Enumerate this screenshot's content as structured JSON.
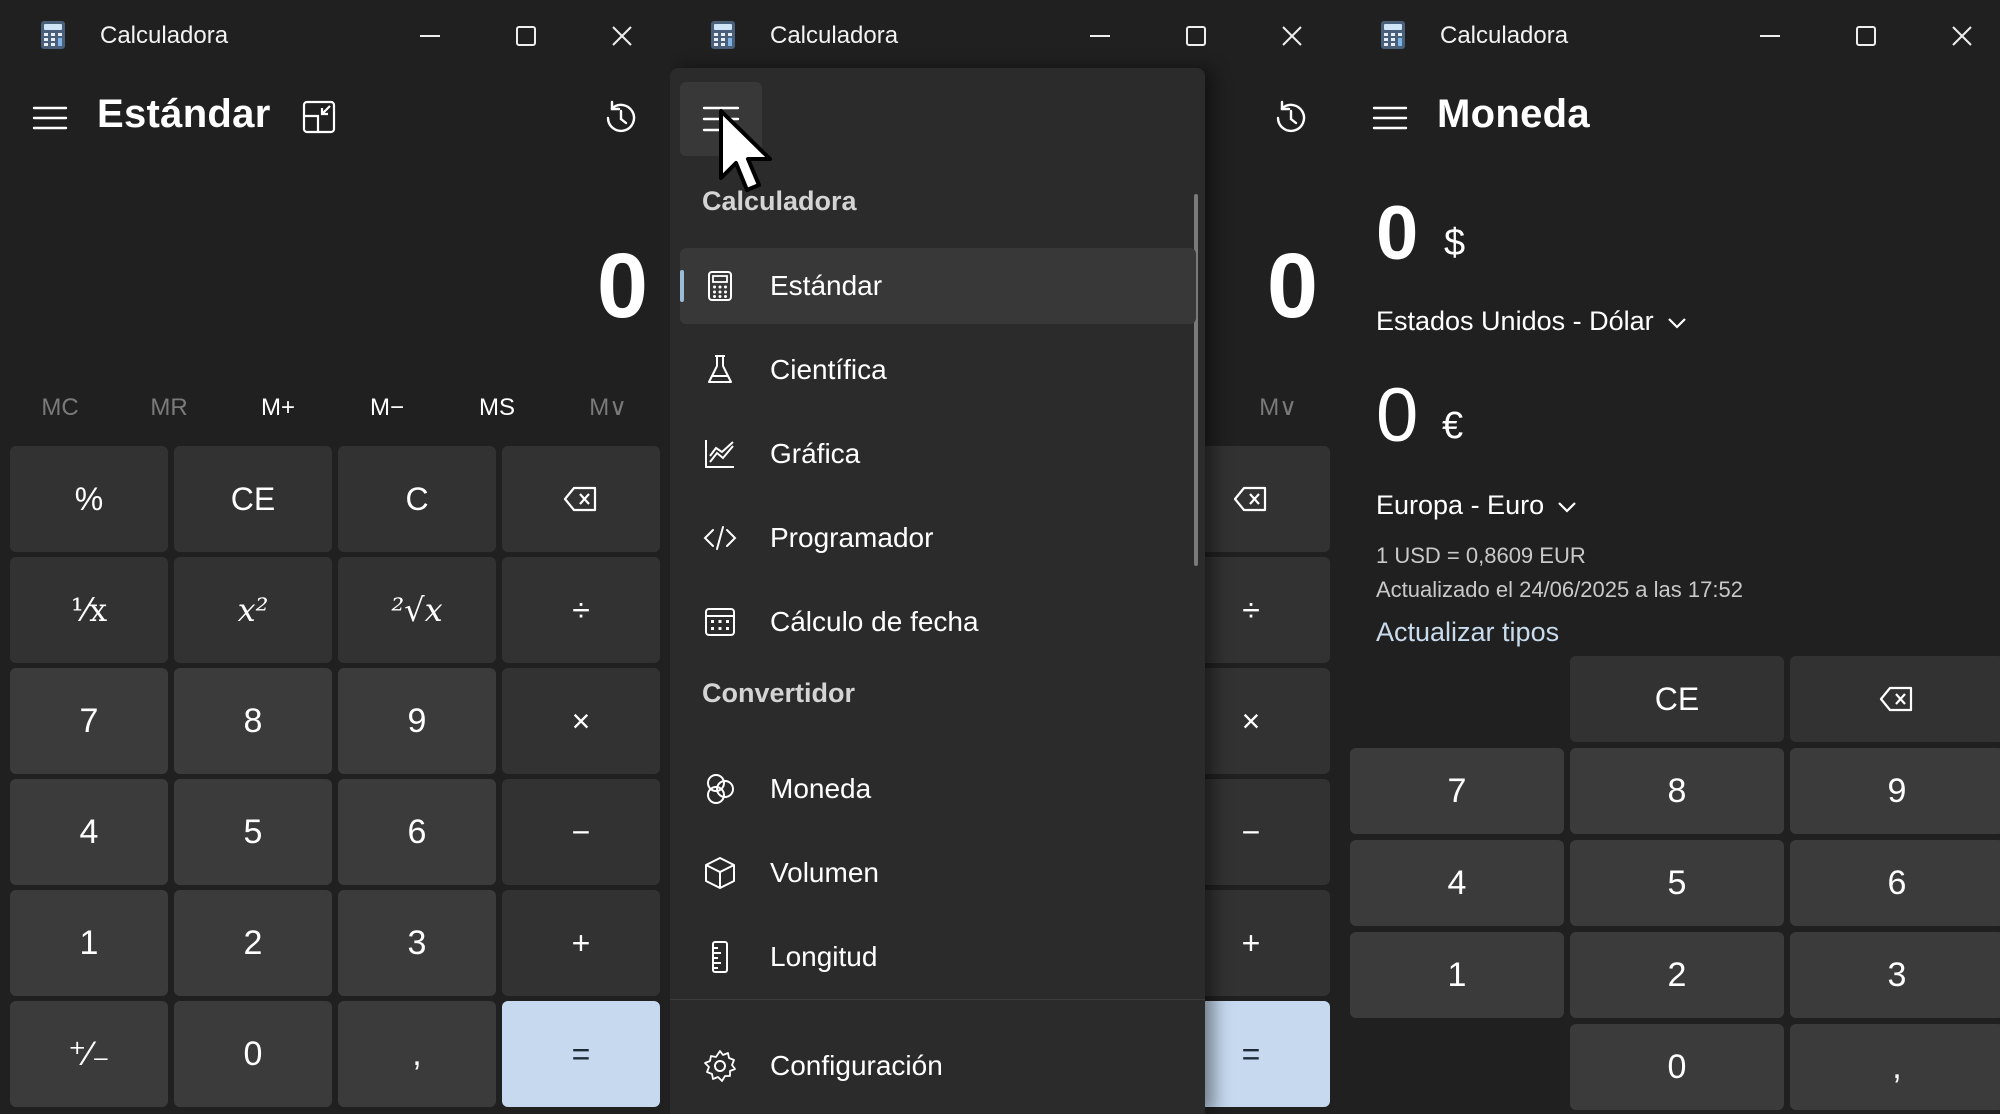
{
  "app_title": "Calculadora",
  "window1": {
    "mode_title": "Estándar",
    "display": "0",
    "memory": [
      "MC",
      "MR",
      "M+",
      "M−",
      "MS",
      "M∨"
    ],
    "keys": [
      [
        "%",
        "CE",
        "C",
        "⌫"
      ],
      [
        "¹⁄x",
        "x²",
        "²√x",
        "÷"
      ],
      [
        "7",
        "8",
        "9",
        "×"
      ],
      [
        "4",
        "5",
        "6",
        "−"
      ],
      [
        "1",
        "2",
        "3",
        "+"
      ],
      [
        "⁺⁄₋",
        "0",
        ",",
        "="
      ]
    ]
  },
  "window2": {
    "display": "0",
    "memory_partial": "M∨",
    "menu": {
      "section_calc": "Calculadora",
      "calc_items": [
        {
          "label": "Estándar",
          "icon": "calculator-icon",
          "selected": true
        },
        {
          "label": "Científica",
          "icon": "flask-icon"
        },
        {
          "label": "Gráfica",
          "icon": "graph-icon"
        },
        {
          "label": "Programador",
          "icon": "code-icon"
        },
        {
          "label": "Cálculo de fecha",
          "icon": "calendar-icon"
        }
      ],
      "section_conv": "Convertidor",
      "conv_items": [
        {
          "label": "Moneda",
          "icon": "currency-icon"
        },
        {
          "label": "Volumen",
          "icon": "cube-icon"
        },
        {
          "label": "Longitud",
          "icon": "ruler-icon"
        }
      ],
      "settings_label": "Configuración"
    }
  },
  "window3": {
    "mode_title": "Moneda",
    "from_value": "0",
    "from_symbol": "$",
    "from_currency": "Estados Unidos - Dólar",
    "to_value": "0",
    "to_symbol": "€",
    "to_currency": "Europa - Euro",
    "rate": "1 USD = 0,8609 EUR",
    "updated": "Actualizado el 24/06/2025 a las 17:52",
    "refresh_link": "Actualizar tipos",
    "keys": [
      [
        "",
        "CE",
        "⌫"
      ],
      [
        "7",
        "8",
        "9"
      ],
      [
        "4",
        "5",
        "6"
      ],
      [
        "1",
        "2",
        "3"
      ],
      [
        "",
        "0",
        ","
      ]
    ]
  },
  "colors": {
    "background": "#202020",
    "key": "#3b3b3b",
    "op_key": "#323232",
    "equals_key": "#c6d9ef",
    "accent": "#9bbcd9"
  }
}
